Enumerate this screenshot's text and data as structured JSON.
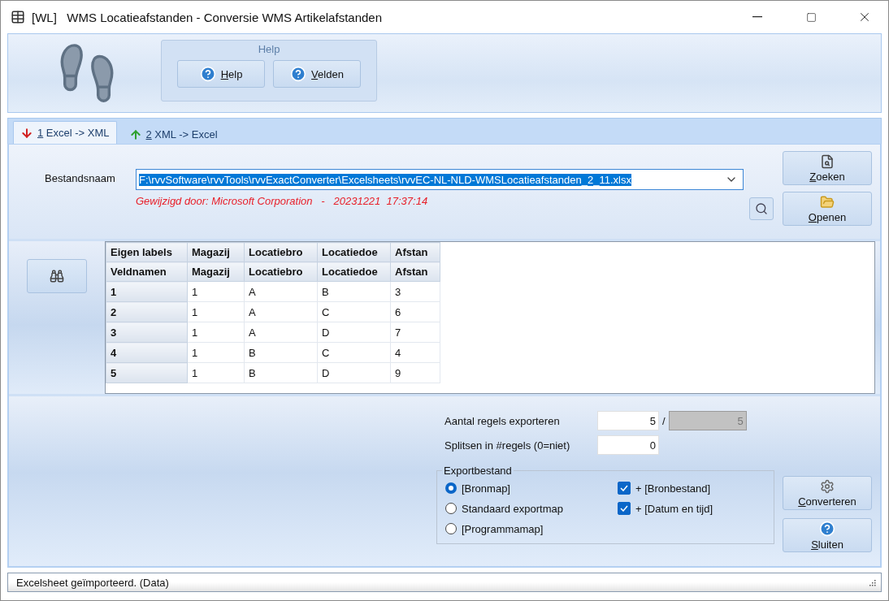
{
  "window": {
    "title": "[WL]   WMS Locatieafstanden - Conversie WMS Artikelafstanden"
  },
  "help_group": {
    "title": "Help",
    "buttons": [
      {
        "label": "Help",
        "mnemonic": true
      },
      {
        "label": "Velden",
        "mnemonic": true
      }
    ]
  },
  "tabs": [
    {
      "label": "1 Excel -> XML",
      "selected": true,
      "mnemonic": true
    },
    {
      "label": "2 XML -> Excel",
      "selected": false,
      "mnemonic": true
    }
  ],
  "file": {
    "label": "Bestandsnaam",
    "value": "F:\\rvvSoftware\\rvvTools\\rvvExactConverter\\Excelsheets\\rvvEC-NL-NLD-WMSLocatieafstanden_2_11.xlsx",
    "selected": true,
    "note": "Gewijzigd door: Microsoft Corporation   -   20231221  17:37:14"
  },
  "file_buttons": [
    {
      "label": "Zoeken",
      "kind": "search",
      "mnemonic": true
    },
    {
      "label": "Openen",
      "kind": "open",
      "mnemonic": true
    }
  ],
  "grid": {
    "header_rows": [
      [
        "Eigen labels",
        "Magazij",
        "Locatiebro",
        "Locatiedoe",
        "Afstan"
      ],
      [
        "Veldnamen",
        "Magazij",
        "Locatiebro",
        "Locatiedoe",
        "Afstan"
      ]
    ],
    "rows": [
      [
        "1",
        "1",
        "A",
        "B",
        "3"
      ],
      [
        "2",
        "1",
        "A",
        "C",
        "6"
      ],
      [
        "3",
        "1",
        "A",
        "D",
        "7"
      ],
      [
        "4",
        "1",
        "B",
        "C",
        "4"
      ],
      [
        "5",
        "1",
        "B",
        "D",
        "9"
      ]
    ]
  },
  "export": {
    "rows_label": "Aantal regels exporteren",
    "rows_value": "5",
    "separator": "/",
    "rows_total": "5",
    "split_label": "Splitsen in #regels (0=niet)",
    "split_value": "0",
    "group_title": "Exportbestand",
    "radios": [
      {
        "label": "[Bronmap]",
        "selected": true
      },
      {
        "label": "Standaard exportmap",
        "selected": false
      },
      {
        "label": "[Programmamap]",
        "selected": false
      }
    ],
    "checkboxes": [
      {
        "label": "+ [Bronbestand]",
        "checked": true
      },
      {
        "label": "+ [Datum en tijd]",
        "checked": true
      }
    ]
  },
  "action_buttons": [
    {
      "label": "Converteren",
      "kind": "convert",
      "mnemonic": true
    },
    {
      "label": "Sluiten",
      "kind": "close",
      "mnemonic": true
    }
  ],
  "status_bar": {
    "text": "Excelsheet geïmporteerd. (Data)"
  }
}
